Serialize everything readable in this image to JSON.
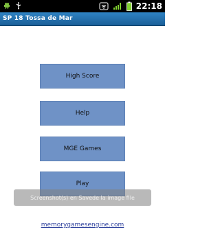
{
  "status_bar": {
    "time": "22:18",
    "left_icons": [
      "android-icon",
      "usb-icon"
    ],
    "right_icons": [
      "wifi-icon",
      "signal-icon",
      "battery-icon"
    ]
  },
  "title_bar": {
    "title": "SP 18 Tossa de Mar"
  },
  "menu": {
    "buttons": [
      {
        "label": "High Score"
      },
      {
        "label": "Help"
      },
      {
        "label": "MGE Games"
      },
      {
        "label": "Play"
      }
    ]
  },
  "toast": {
    "text": "Screenshot(s) en Savede la image file"
  },
  "footer": {
    "link_text": "memorygamesengine.com"
  },
  "colors": {
    "button_bg": "#6f92c6",
    "title_bar": "#2f83c3",
    "status_bar": "#000000",
    "link": "#2c3f9c"
  }
}
